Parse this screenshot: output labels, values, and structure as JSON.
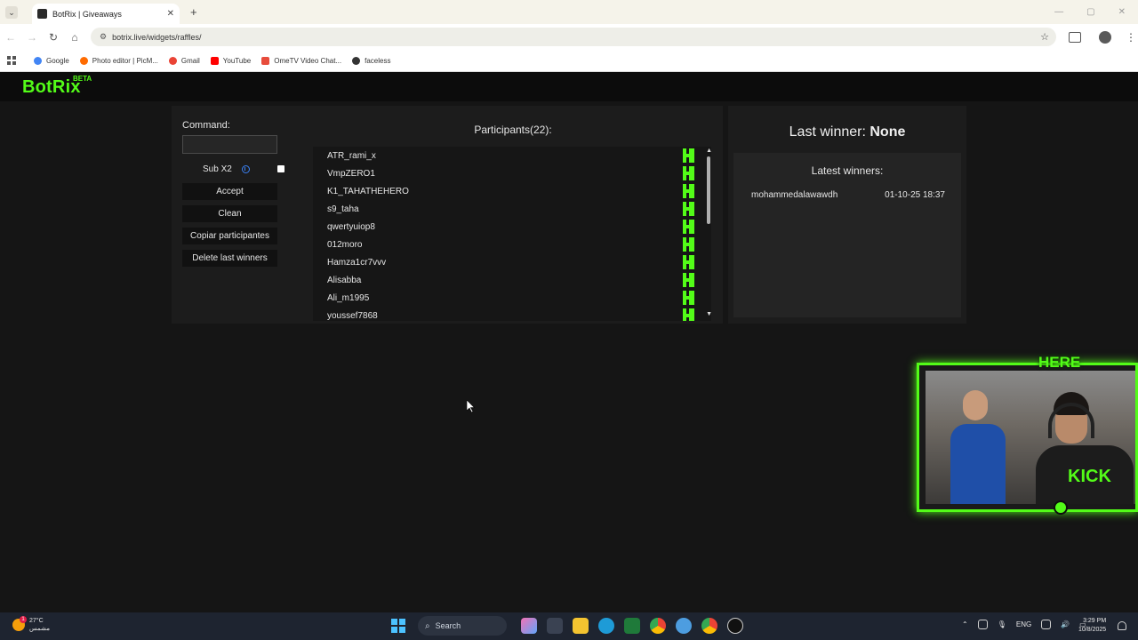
{
  "browser": {
    "tab_title": "BotRix | Giveaways",
    "tab_close": "✕",
    "new_tab": "+",
    "url": "botrix.live/widgets/raffles/",
    "bookmarks": [
      {
        "label": "Google",
        "icon": "google-icon",
        "color": "#4285f4"
      },
      {
        "label": "Photo editor | PicM...",
        "icon": "picsart-icon",
        "color": "#ff6b00"
      },
      {
        "label": "Gmail",
        "icon": "gmail-icon",
        "color": "#ea4335"
      },
      {
        "label": "YouTube",
        "icon": "youtube-icon",
        "color": "#ff0000"
      },
      {
        "label": "OmeTV Video Chat...",
        "icon": "ometv-icon",
        "color": "#e74c3c"
      },
      {
        "label": "faceless",
        "icon": "faceless-icon",
        "color": "#333333"
      }
    ]
  },
  "site": {
    "logo": "BotRix",
    "logo_badge": "BETA",
    "accent_color": "#53fc18"
  },
  "raffle": {
    "command_label": "Command:",
    "command_value": "",
    "sub_label": "Sub X2",
    "sub_checked": false,
    "buttons": {
      "accept": "Accept",
      "clean": "Clean",
      "copy": "Copiar participantes",
      "delete": "Delete last winners"
    },
    "participants_title": "Participants(22):",
    "participants": [
      "ATR_rami_x",
      "VmpZERO1",
      "K1_TAHATHEHERO",
      "s9_taha",
      "qwertyuiop8",
      "012moro",
      "Hamza1cr7vvv",
      "Alisabba",
      "Ali_m1995",
      "youssef7868"
    ]
  },
  "winners": {
    "last_winner_label": "Last winner:",
    "last_winner_value": "None",
    "latest_title": "Latest winners:",
    "latest": [
      {
        "name": "mohammedalawawdh",
        "date": "01-10-25 18:37"
      }
    ]
  },
  "overlay": {
    "badge_text": "HERE",
    "shirt_logo": "KICK"
  },
  "taskbar": {
    "weather_temp": "27°C",
    "weather_desc": "مشمس",
    "weather_badge": "1",
    "search_placeholder": "Search",
    "language": "ENG",
    "time": "3:29 PM",
    "date": "10/8/2025"
  }
}
